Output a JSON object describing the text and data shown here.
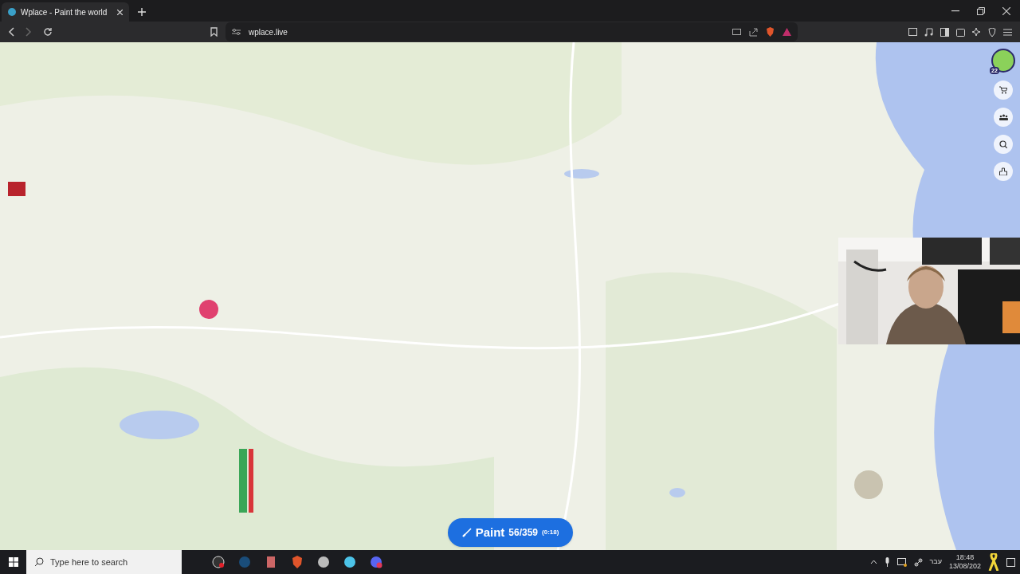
{
  "browser": {
    "tabs": [
      {
        "title": "Wplace - Paint the world",
        "selected": true
      }
    ],
    "url": "wplace.live"
  },
  "game": {
    "level_badge": "22",
    "paint_button": {
      "label": "Paint",
      "charges": "56/359",
      "timer": "(0:18)"
    }
  },
  "taskbar": {
    "search_placeholder": "Type here to search",
    "language": "עבר",
    "time": "18:48",
    "date": "13/08/202"
  }
}
